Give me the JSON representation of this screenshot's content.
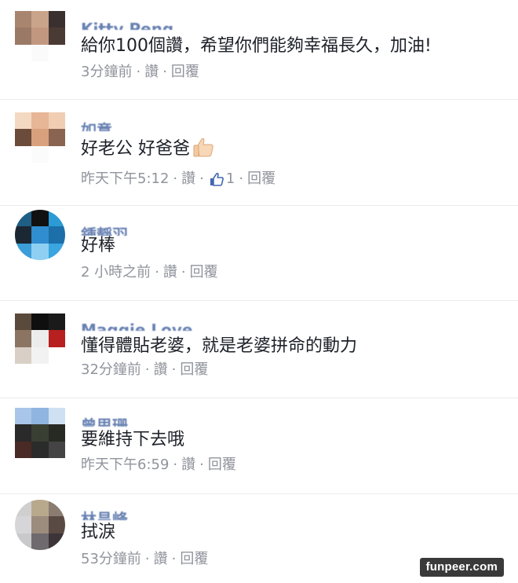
{
  "comments": [
    {
      "name": "Kitty Peng",
      "text": "給你100個讚，希望你們能夠幸福長久，加油!",
      "time": "3分鐘前",
      "like_label": "讚",
      "reply_label": "回覆"
    },
    {
      "name": "如意",
      "text": "好老公 好爸爸",
      "emoji": "thumbs-up-emoji",
      "time": "昨天下午5:12",
      "like_label": "讚",
      "like_count": "1",
      "reply_label": "回覆"
    },
    {
      "name": "鍾靜羽",
      "text": "好棒",
      "time": "2 小時之前",
      "like_label": "讚",
      "reply_label": "回覆"
    },
    {
      "name": "Maggie Love",
      "text": "懂得體貼老婆，就是老婆拼命的動力",
      "time": "32分鐘前",
      "like_label": "讚",
      "reply_label": "回覆"
    },
    {
      "name": "曾思珊",
      "text": "要維持下去哦",
      "time": "昨天下午6:59",
      "like_label": "讚",
      "reply_label": "回覆"
    },
    {
      "name": "林昌峰",
      "text": "拭淚",
      "time": "53分鐘前",
      "like_label": "讚",
      "reply_label": "回覆"
    }
  ],
  "separator": "·",
  "watermark": "funpeer.com",
  "colors": {
    "name_link": "#365899",
    "meta_text": "#90949c",
    "like_icon": "#4267b2",
    "divider": "#e9ebee"
  }
}
